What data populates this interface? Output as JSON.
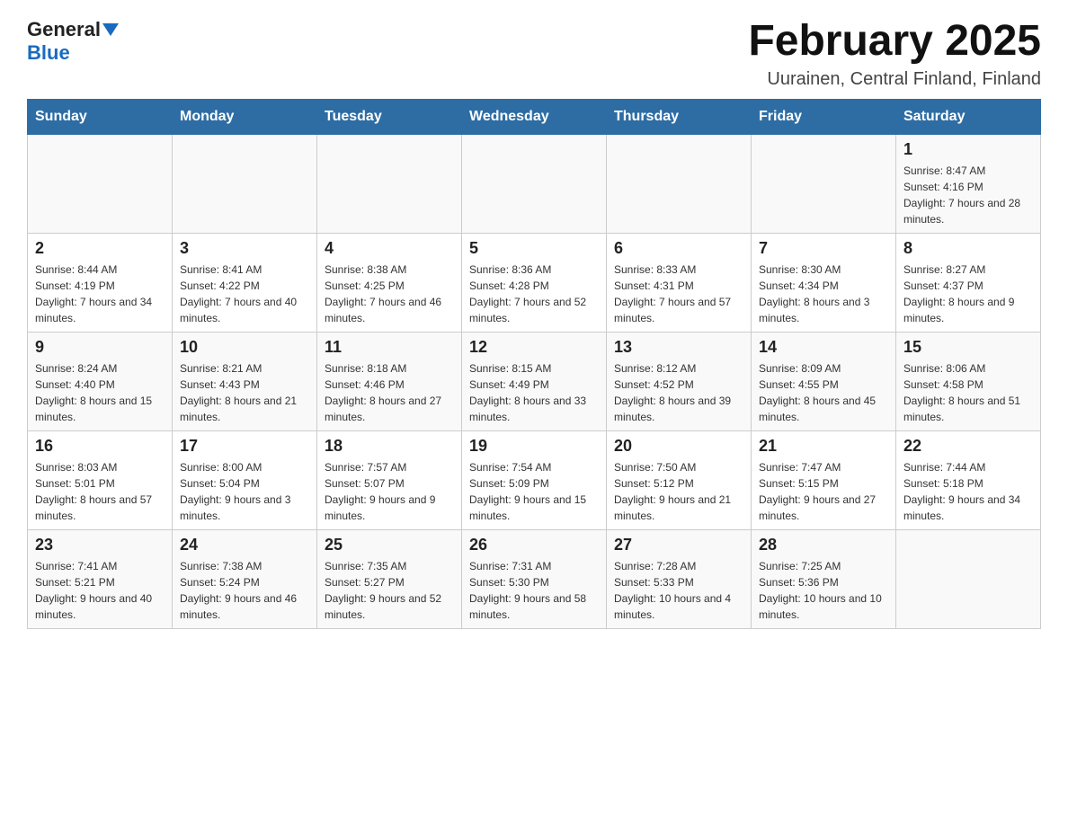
{
  "header": {
    "logo_general": "General",
    "logo_blue": "Blue",
    "month_title": "February 2025",
    "location": "Uurainen, Central Finland, Finland"
  },
  "weekdays": [
    "Sunday",
    "Monday",
    "Tuesday",
    "Wednesday",
    "Thursday",
    "Friday",
    "Saturday"
  ],
  "weeks": [
    [
      {
        "day": "",
        "sunrise": "",
        "sunset": "",
        "daylight": ""
      },
      {
        "day": "",
        "sunrise": "",
        "sunset": "",
        "daylight": ""
      },
      {
        "day": "",
        "sunrise": "",
        "sunset": "",
        "daylight": ""
      },
      {
        "day": "",
        "sunrise": "",
        "sunset": "",
        "daylight": ""
      },
      {
        "day": "",
        "sunrise": "",
        "sunset": "",
        "daylight": ""
      },
      {
        "day": "",
        "sunrise": "",
        "sunset": "",
        "daylight": ""
      },
      {
        "day": "1",
        "sunrise": "Sunrise: 8:47 AM",
        "sunset": "Sunset: 4:16 PM",
        "daylight": "Daylight: 7 hours and 28 minutes."
      }
    ],
    [
      {
        "day": "2",
        "sunrise": "Sunrise: 8:44 AM",
        "sunset": "Sunset: 4:19 PM",
        "daylight": "Daylight: 7 hours and 34 minutes."
      },
      {
        "day": "3",
        "sunrise": "Sunrise: 8:41 AM",
        "sunset": "Sunset: 4:22 PM",
        "daylight": "Daylight: 7 hours and 40 minutes."
      },
      {
        "day": "4",
        "sunrise": "Sunrise: 8:38 AM",
        "sunset": "Sunset: 4:25 PM",
        "daylight": "Daylight: 7 hours and 46 minutes."
      },
      {
        "day": "5",
        "sunrise": "Sunrise: 8:36 AM",
        "sunset": "Sunset: 4:28 PM",
        "daylight": "Daylight: 7 hours and 52 minutes."
      },
      {
        "day": "6",
        "sunrise": "Sunrise: 8:33 AM",
        "sunset": "Sunset: 4:31 PM",
        "daylight": "Daylight: 7 hours and 57 minutes."
      },
      {
        "day": "7",
        "sunrise": "Sunrise: 8:30 AM",
        "sunset": "Sunset: 4:34 PM",
        "daylight": "Daylight: 8 hours and 3 minutes."
      },
      {
        "day": "8",
        "sunrise": "Sunrise: 8:27 AM",
        "sunset": "Sunset: 4:37 PM",
        "daylight": "Daylight: 8 hours and 9 minutes."
      }
    ],
    [
      {
        "day": "9",
        "sunrise": "Sunrise: 8:24 AM",
        "sunset": "Sunset: 4:40 PM",
        "daylight": "Daylight: 8 hours and 15 minutes."
      },
      {
        "day": "10",
        "sunrise": "Sunrise: 8:21 AM",
        "sunset": "Sunset: 4:43 PM",
        "daylight": "Daylight: 8 hours and 21 minutes."
      },
      {
        "day": "11",
        "sunrise": "Sunrise: 8:18 AM",
        "sunset": "Sunset: 4:46 PM",
        "daylight": "Daylight: 8 hours and 27 minutes."
      },
      {
        "day": "12",
        "sunrise": "Sunrise: 8:15 AM",
        "sunset": "Sunset: 4:49 PM",
        "daylight": "Daylight: 8 hours and 33 minutes."
      },
      {
        "day": "13",
        "sunrise": "Sunrise: 8:12 AM",
        "sunset": "Sunset: 4:52 PM",
        "daylight": "Daylight: 8 hours and 39 minutes."
      },
      {
        "day": "14",
        "sunrise": "Sunrise: 8:09 AM",
        "sunset": "Sunset: 4:55 PM",
        "daylight": "Daylight: 8 hours and 45 minutes."
      },
      {
        "day": "15",
        "sunrise": "Sunrise: 8:06 AM",
        "sunset": "Sunset: 4:58 PM",
        "daylight": "Daylight: 8 hours and 51 minutes."
      }
    ],
    [
      {
        "day": "16",
        "sunrise": "Sunrise: 8:03 AM",
        "sunset": "Sunset: 5:01 PM",
        "daylight": "Daylight: 8 hours and 57 minutes."
      },
      {
        "day": "17",
        "sunrise": "Sunrise: 8:00 AM",
        "sunset": "Sunset: 5:04 PM",
        "daylight": "Daylight: 9 hours and 3 minutes."
      },
      {
        "day": "18",
        "sunrise": "Sunrise: 7:57 AM",
        "sunset": "Sunset: 5:07 PM",
        "daylight": "Daylight: 9 hours and 9 minutes."
      },
      {
        "day": "19",
        "sunrise": "Sunrise: 7:54 AM",
        "sunset": "Sunset: 5:09 PM",
        "daylight": "Daylight: 9 hours and 15 minutes."
      },
      {
        "day": "20",
        "sunrise": "Sunrise: 7:50 AM",
        "sunset": "Sunset: 5:12 PM",
        "daylight": "Daylight: 9 hours and 21 minutes."
      },
      {
        "day": "21",
        "sunrise": "Sunrise: 7:47 AM",
        "sunset": "Sunset: 5:15 PM",
        "daylight": "Daylight: 9 hours and 27 minutes."
      },
      {
        "day": "22",
        "sunrise": "Sunrise: 7:44 AM",
        "sunset": "Sunset: 5:18 PM",
        "daylight": "Daylight: 9 hours and 34 minutes."
      }
    ],
    [
      {
        "day": "23",
        "sunrise": "Sunrise: 7:41 AM",
        "sunset": "Sunset: 5:21 PM",
        "daylight": "Daylight: 9 hours and 40 minutes."
      },
      {
        "day": "24",
        "sunrise": "Sunrise: 7:38 AM",
        "sunset": "Sunset: 5:24 PM",
        "daylight": "Daylight: 9 hours and 46 minutes."
      },
      {
        "day": "25",
        "sunrise": "Sunrise: 7:35 AM",
        "sunset": "Sunset: 5:27 PM",
        "daylight": "Daylight: 9 hours and 52 minutes."
      },
      {
        "day": "26",
        "sunrise": "Sunrise: 7:31 AM",
        "sunset": "Sunset: 5:30 PM",
        "daylight": "Daylight: 9 hours and 58 minutes."
      },
      {
        "day": "27",
        "sunrise": "Sunrise: 7:28 AM",
        "sunset": "Sunset: 5:33 PM",
        "daylight": "Daylight: 10 hours and 4 minutes."
      },
      {
        "day": "28",
        "sunrise": "Sunrise: 7:25 AM",
        "sunset": "Sunset: 5:36 PM",
        "daylight": "Daylight: 10 hours and 10 minutes."
      },
      {
        "day": "",
        "sunrise": "",
        "sunset": "",
        "daylight": ""
      }
    ]
  ]
}
